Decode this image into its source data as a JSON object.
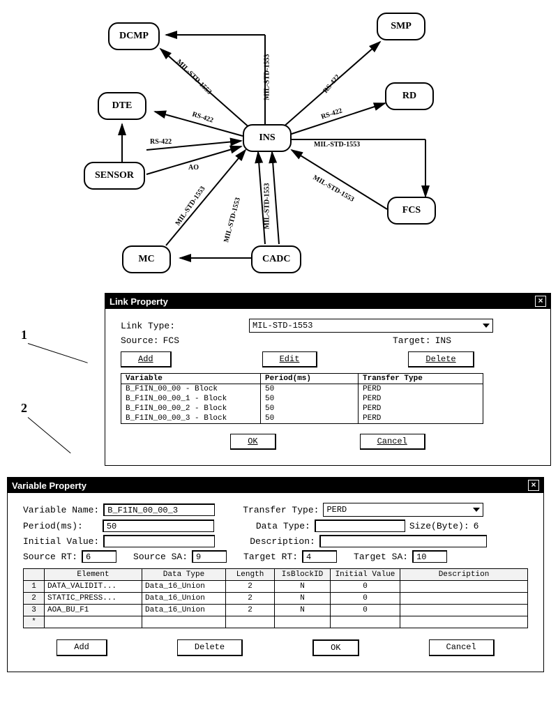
{
  "diagram": {
    "nodes": {
      "dcmp": "DCMP",
      "smp": "SMP",
      "dte": "DTE",
      "rd": "RD",
      "ins": "INS",
      "sensor": "SENSOR",
      "fcs": "FCS",
      "mc": "MC",
      "cadc": "CADC"
    },
    "edges": {
      "dcmp_ins": "MIL-STD-1553",
      "smp_ins": "RS-422",
      "dte_ins": "RS-422",
      "rd_ins": "RS-422",
      "sensor_dte": "RS-422",
      "sensor_ins": "AO",
      "mc_ins": "MIL-STD-1553",
      "cadc_mc": "MIL-STD-1553",
      "cadc_ins": "MIL-STD-1553",
      "ins_fcs_top": "MIL-STD-1553",
      "fcs_ins": "MIL-STD-1553",
      "ins_topmid": "MIL-STD-1553"
    }
  },
  "annotations": {
    "a1": "1",
    "a2": "2"
  },
  "link_property": {
    "title": "Link Property",
    "link_type_label": "Link Type:",
    "link_type_value": "MIL-STD-1553",
    "source_label": "Source:",
    "source_value": "FCS",
    "target_label": "Target:",
    "target_value": "INS",
    "btn_add": "Add",
    "btn_edit": "Edit",
    "btn_delete": "Delete",
    "btn_ok": "OK",
    "btn_cancel": "Cancel",
    "cols": {
      "c1": "Variable",
      "c2": "Period(ms)",
      "c3": "Transfer Type"
    },
    "rows": [
      {
        "variable": "B_F1IN_00_00 - Block",
        "period": "50",
        "transfer": "PERD"
      },
      {
        "variable": "B_F1IN_00_00_1 - Block",
        "period": "50",
        "transfer": "PERD"
      },
      {
        "variable": "B_F1IN_00_00_2 - Block",
        "period": "50",
        "transfer": "PERD"
      },
      {
        "variable": "B_F1IN_00_00_3 - Block",
        "period": "50",
        "transfer": "PERD"
      }
    ]
  },
  "variable_property": {
    "title": "Variable Property",
    "varname_label": "Variable Name:",
    "varname_value": "B_F1IN_00_00_3",
    "transfer_label": "Transfer Type:",
    "transfer_value": "PERD",
    "period_label": "Period(ms):",
    "period_value": "50",
    "datatype_label": "Data Type:",
    "datatype_value": "",
    "size_label": "Size(Byte):",
    "size_value": "6",
    "initval_label": "Initial Value:",
    "initval_value": "",
    "desc_label": "Description:",
    "desc_value": "",
    "src_rt_label": "Source RT:",
    "src_rt_value": "6",
    "src_sa_label": "Source SA:",
    "src_sa_value": "9",
    "tgt_rt_label": "Target RT:",
    "tgt_rt_value": "4",
    "tgt_sa_label": "Target SA:",
    "tgt_sa_value": "10",
    "cols": {
      "c1": "Element",
      "c2": "Data Type",
      "c3": "Length",
      "c4": "IsBlockID",
      "c5": "Initial Value",
      "c6": "Description"
    },
    "rows": [
      {
        "n": "1",
        "element": "DATA_VALIDIT...",
        "dtype": "Data_16_Union",
        "len": "2",
        "isblk": "N",
        "init": "0",
        "desc": ""
      },
      {
        "n": "2",
        "element": "STATIC_PRESS...",
        "dtype": "Data_16_Union",
        "len": "2",
        "isblk": "N",
        "init": "0",
        "desc": ""
      },
      {
        "n": "3",
        "element": "AOA_BU_F1",
        "dtype": "Data_16_Union",
        "len": "2",
        "isblk": "N",
        "init": "0",
        "desc": ""
      }
    ],
    "btn_add": "Add",
    "btn_delete": "Delete",
    "btn_ok": "OK",
    "btn_cancel": "Cancel"
  }
}
